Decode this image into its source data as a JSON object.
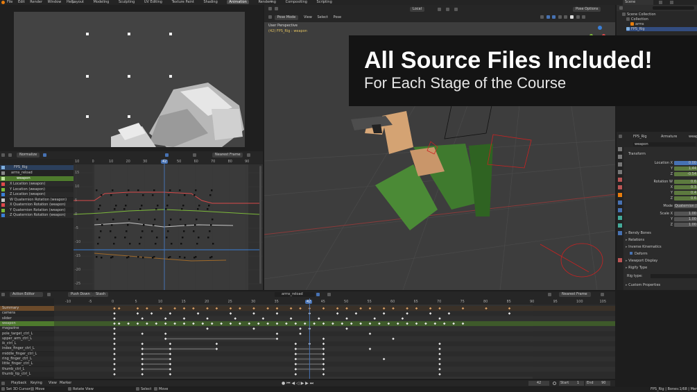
{
  "menu": [
    "File",
    "Edit",
    "Render",
    "Window",
    "Help"
  ],
  "workspaces": [
    "Layout",
    "Modeling",
    "Sculpting",
    "UV Editing",
    "Texture Paint",
    "Shading",
    "Animation",
    "Rendering",
    "Compositing",
    "Scripting"
  ],
  "active_workspace": "Animation",
  "scene_name": "Scene",
  "viewport": {
    "mode": "Pose Mode",
    "menus": [
      "View",
      "Select",
      "Pose"
    ],
    "orientation": "Local",
    "perspective": "User Perspective",
    "object": "(42) FPS_Rig : weapon",
    "pose_options": "Pose Options"
  },
  "banner": {
    "title": "All Source Files Included!",
    "subtitle": "For Each Stage of the Course"
  },
  "outliner": {
    "items": [
      "Scene Collection",
      "Collection",
      "arms",
      "FPS_Rig"
    ]
  },
  "graph_editor": {
    "normalize": "Normalize",
    "snap": "Nearest Frame",
    "ruler": [
      "10",
      "0",
      "10",
      "20",
      "30",
      "42",
      "50",
      "60",
      "70",
      "80",
      "90"
    ],
    "current_frame": "42",
    "object": "FPS_Rig",
    "action": "arms_reload",
    "group": "weapon",
    "channels": [
      {
        "label": "X Location (weapon)",
        "color": "#e0484a"
      },
      {
        "label": "Y Location (weapon)",
        "color": "#7dba3a"
      },
      {
        "label": "Z Location (weapon)",
        "color": "#3a7fd6"
      },
      {
        "label": "W Quaternion Rotation (weapon)",
        "color": "#c8c8c8"
      },
      {
        "label": "X Quaternion Rotation (weapon)",
        "color": "#e0484a"
      },
      {
        "label": "Y Quaternion Rotation (weapon)",
        "color": "#7dba3a"
      },
      {
        "label": "Z Quaternion Rotation (weapon)",
        "color": "#3a7fd6"
      }
    ],
    "y_ticks": [
      "15",
      "10",
      "5",
      "0",
      "-5",
      "-10",
      "-15",
      "-20",
      "-25"
    ]
  },
  "properties": {
    "tabs": [
      "FPS_Rig",
      "Armature",
      "weapon"
    ],
    "bone_name": "weapon",
    "transform_label": "Transform",
    "location": [
      {
        "label": "Location X",
        "value": "0.00"
      },
      {
        "label": "Y",
        "value": "1.44"
      },
      {
        "label": "Z",
        "value": "-0.54"
      }
    ],
    "rotation": [
      {
        "label": "Rotation W",
        "value": "0.6"
      },
      {
        "label": "X",
        "value": "0.3"
      },
      {
        "label": "Y",
        "value": "0.4"
      },
      {
        "label": "Z",
        "value": "0.6"
      }
    ],
    "mode_label": "Mode",
    "mode_value": "Quaternion (W",
    "scale": [
      {
        "label": "Scale X",
        "value": "1.00"
      },
      {
        "label": "Y",
        "value": "1.00"
      },
      {
        "label": "Z",
        "value": "1.00"
      }
    ],
    "sections": [
      "Bendy Bones",
      "Relations",
      "Inverse Kinematics",
      "Deform",
      "Viewport Display",
      "Rigify Type"
    ],
    "rig_type_label": "Rig type:",
    "custom": "Custom Properties"
  },
  "dopesheet": {
    "mode": "Action Editor",
    "push_down": "Push Down",
    "stash": "Stash",
    "action": "arms_reload",
    "snap": "Nearest Frame",
    "ruler": [
      "-10",
      "-5",
      "0",
      "5",
      "10",
      "15",
      "20",
      "25",
      "30",
      "35",
      "42",
      "45",
      "50",
      "55",
      "60",
      "65",
      "70",
      "75",
      "80",
      "85",
      "90",
      "95",
      "100",
      "105"
    ],
    "current_frame": "42",
    "channels": [
      "Summary",
      "camera",
      "slider",
      "weapon",
      "magazine",
      "pole_target_ctrl_L",
      "upper_arm_ctrl_L",
      "ik_ctrl_L",
      "index_finger_ctrl_L",
      "middle_finger_ctrl_L",
      "ring_finger_ctrl_L",
      "little_finger_ctrl_L",
      "thumb_ctrl_L",
      "thumb_tip_ctrl_L"
    ]
  },
  "timeline": {
    "menus": [
      "Playback",
      "Keying",
      "View",
      "Marker"
    ],
    "frame": "42",
    "start_label": "Start",
    "start": "1",
    "end_label": "End",
    "end": "90"
  },
  "status": {
    "items": [
      "Set 3D Cursor",
      "Move",
      "Rotate View",
      "Select",
      "Move"
    ],
    "right": "FPS_Rig | Bones:1/68 | Mem:1"
  },
  "colors": {
    "accent": "#4772b3",
    "keyframe": "#e8e8e8",
    "selected_row": "#4e7a2d",
    "summary_row": "#6b4a2a",
    "playhead": "#4772b3"
  }
}
